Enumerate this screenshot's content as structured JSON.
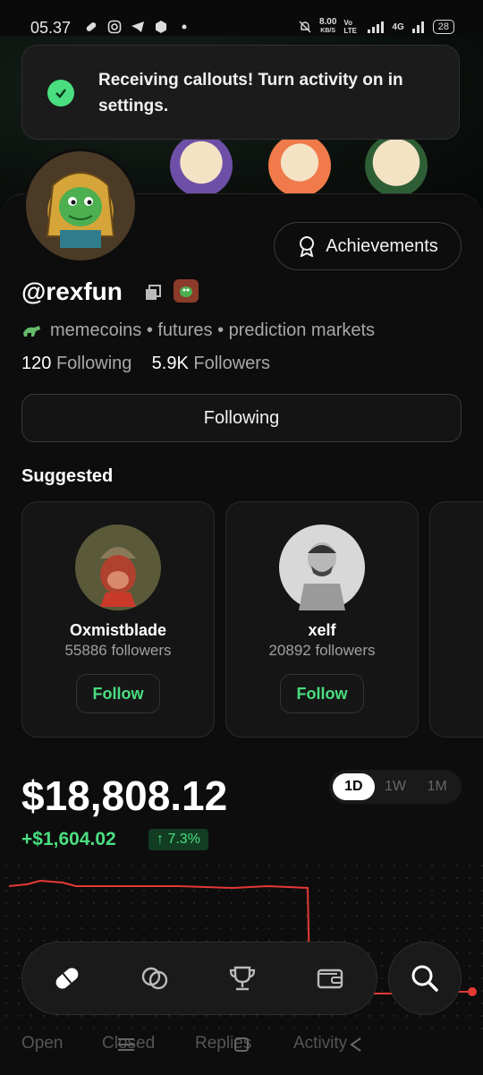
{
  "status_bar": {
    "time": "05.37",
    "net_speed_value": "8.00",
    "net_speed_unit": "KB/S",
    "volte": "Vo LTE",
    "network": "4G",
    "battery": "28"
  },
  "toast": {
    "message": "Receiving callouts! Turn activity on in settings."
  },
  "profile": {
    "achievements_label": "Achievements",
    "username": "@rexfun",
    "bio": "memecoins • futures • prediction markets",
    "following_count": "120",
    "following_label": "Following",
    "followers_count": "5.9K",
    "followers_label": "Followers",
    "following_button": "Following"
  },
  "suggested": {
    "title": "Suggested",
    "items": [
      {
        "name": "Oxmistblade",
        "followers": "55886 followers",
        "button": "Follow"
      },
      {
        "name": "xelf",
        "followers": "20892 followers",
        "button": "Follow"
      }
    ]
  },
  "portfolio": {
    "balance": "$18,808.12",
    "change": "+$1,604.02",
    "change_pct": "↑ 7.3%",
    "ranges": [
      "1D",
      "1W",
      "1M"
    ],
    "active_range": "1D"
  },
  "tabs": [
    "Open",
    "Closed",
    "Replies",
    "Activity"
  ],
  "colors": {
    "accent_green": "#4ade80",
    "chart_line": "#e53935",
    "background": "#0d0d0d"
  },
  "nav": {
    "icons": [
      "pill-icon",
      "coins-icon",
      "trophy-icon",
      "wallet-icon",
      "search-icon"
    ]
  }
}
